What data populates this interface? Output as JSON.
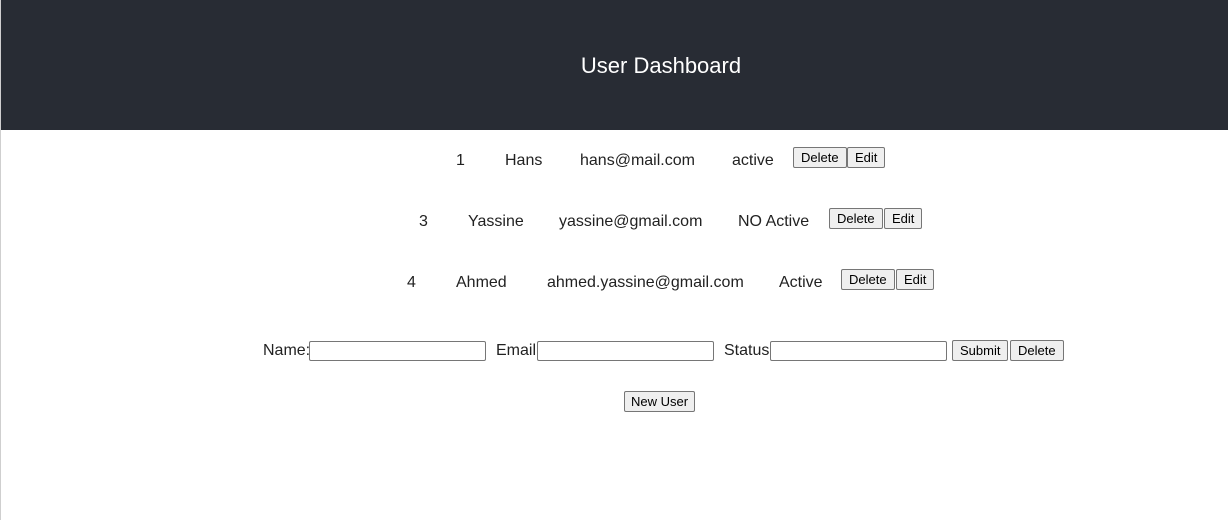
{
  "header": {
    "title": "User Dashboard"
  },
  "users": [
    {
      "id": "1",
      "name": "Hans",
      "email": "hans@mail.com",
      "status": "active",
      "delete_label": "Delete",
      "edit_label": "Edit"
    },
    {
      "id": "3",
      "name": "Yassine",
      "email": "yassine@gmail.com",
      "status": "NO Active",
      "delete_label": "Delete",
      "edit_label": "Edit"
    },
    {
      "id": "4",
      "name": "Ahmed",
      "email": "ahmed.yassine@gmail.com",
      "status": "Active",
      "delete_label": "Delete",
      "edit_label": "Edit"
    }
  ],
  "form": {
    "name_label": "Name:",
    "name_value": "",
    "email_label": "Email:",
    "email_value": "",
    "status_label": "Status:",
    "status_value": "",
    "submit_label": "Submit",
    "delete_label": "Delete"
  },
  "new_user_label": "New User",
  "colors": {
    "header_background": "#282c34",
    "header_text": "#ffffff",
    "button_background": "#efefef",
    "button_border": "#767676"
  }
}
